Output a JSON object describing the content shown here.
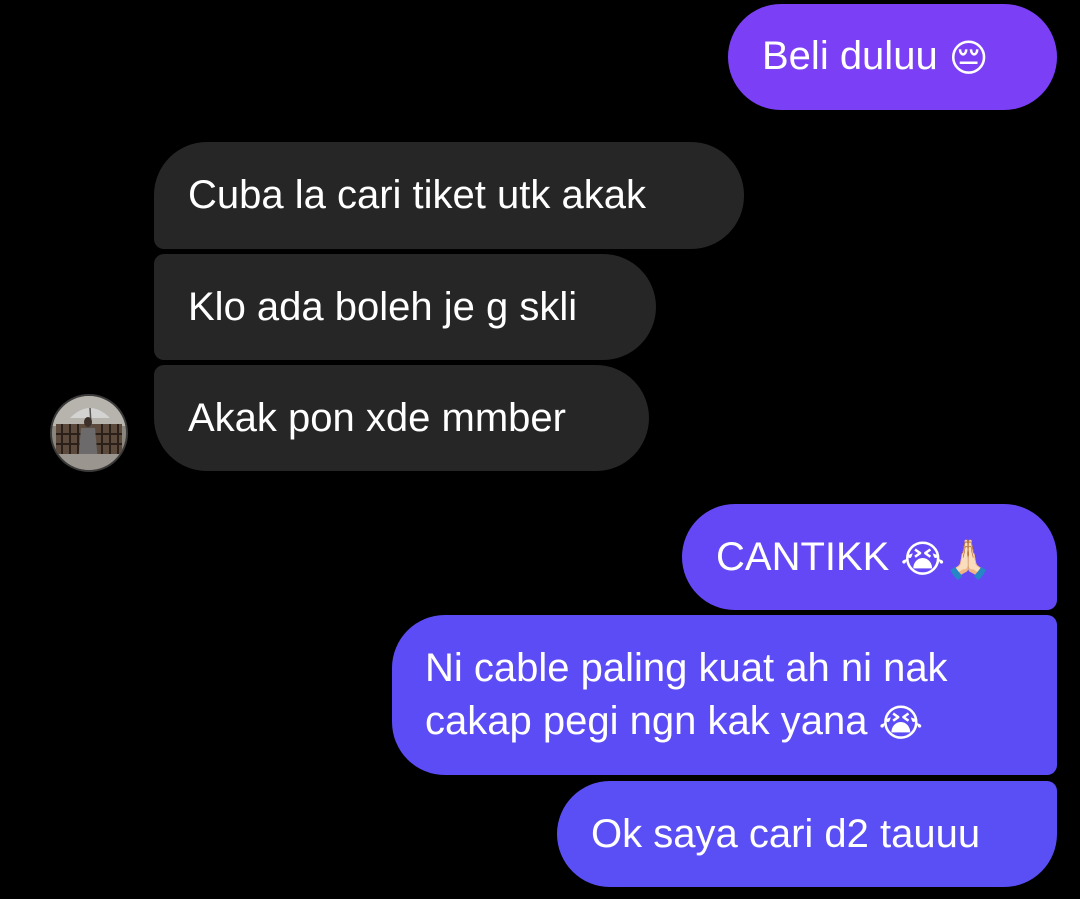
{
  "conversation": {
    "messages": [
      {
        "direction": "outgoing",
        "text": "Beli duluu",
        "emoji": "😔",
        "color": "#7b3ff5"
      },
      {
        "direction": "incoming",
        "text": "Cuba la cari tiket utk akak",
        "color": "#262626"
      },
      {
        "direction": "incoming",
        "text": "Klo ada boleh je g skli",
        "color": "#262626"
      },
      {
        "direction": "incoming",
        "text": "Akak pon xde mmber",
        "color": "#262626"
      },
      {
        "direction": "outgoing",
        "text": "CANTIKK",
        "emoji": "😭🙏🏻",
        "color": "#6448f5"
      },
      {
        "direction": "outgoing",
        "text_line1": "Ni cable paling kuat ah ni nak",
        "text_line2": "cakap pegi ngn kak yana",
        "emoji": "😭",
        "color": "#5c4cf5"
      },
      {
        "direction": "outgoing",
        "text": "Ok saya cari d2 tauuu",
        "color": "#5a4ff4"
      }
    ]
  }
}
